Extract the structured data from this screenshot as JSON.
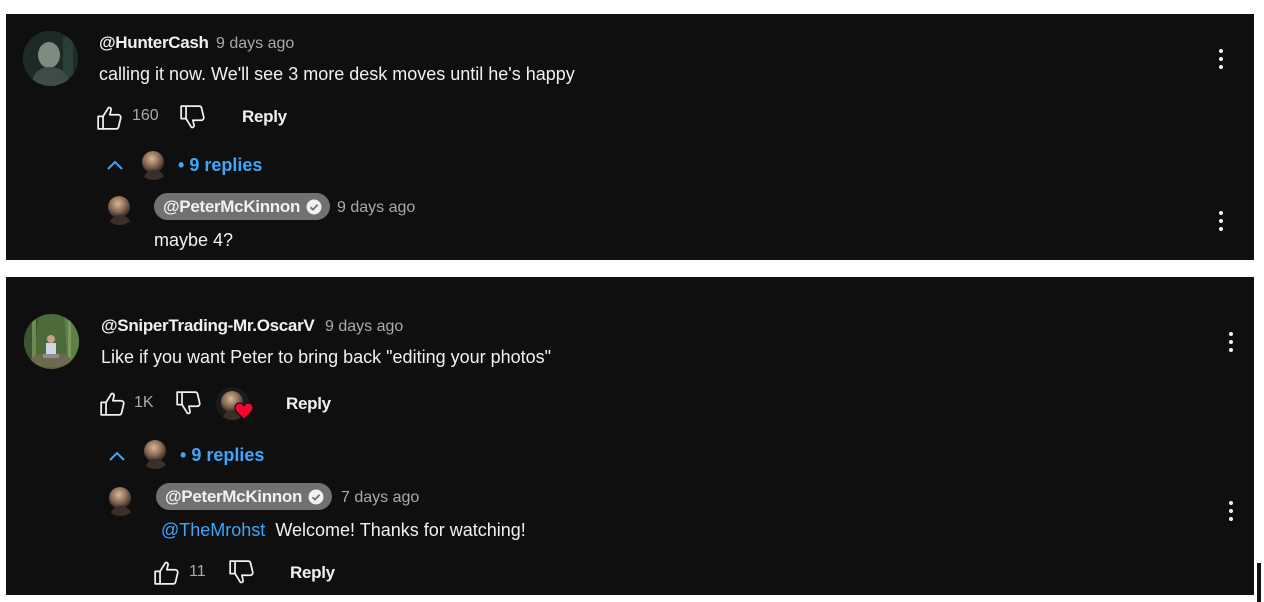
{
  "comments": [
    {
      "username": "@HunterCash",
      "time": "9 days ago",
      "text": "calling it now. We'll see 3 more desk moves until he's happy",
      "likes": "160",
      "reply_label": "Reply",
      "replies_label": "9 replies",
      "reply": {
        "username": "@PeterMcKinnon",
        "time": "9 days ago",
        "text": "maybe 4?"
      }
    },
    {
      "username": "@SniperTrading-Mr.OscarV",
      "time": "9 days ago",
      "text": "Like if you want Peter to bring back \"editing your photos\"",
      "likes": "1K",
      "reply_label": "Reply",
      "replies_label": "9 replies",
      "reply": {
        "username": "@PeterMcKinnon",
        "time": "7 days ago",
        "mention": "@TheMrohst",
        "text": "Welcome! Thanks for watching!",
        "likes": "11",
        "reply_label": "Reply"
      }
    }
  ],
  "icons": {
    "like": "thumbs-up-icon",
    "dislike": "thumbs-down-icon",
    "more": "more-vert-icon",
    "collapse": "chevron-up-icon",
    "verified": "verified-check-icon",
    "heart": "creator-heart-icon"
  },
  "colors": {
    "background": "#0f0f0f",
    "link": "#3ea6ff",
    "secondary_text": "#aaaaaa",
    "creator_chip": "#717171",
    "heart": "#ff0033"
  }
}
